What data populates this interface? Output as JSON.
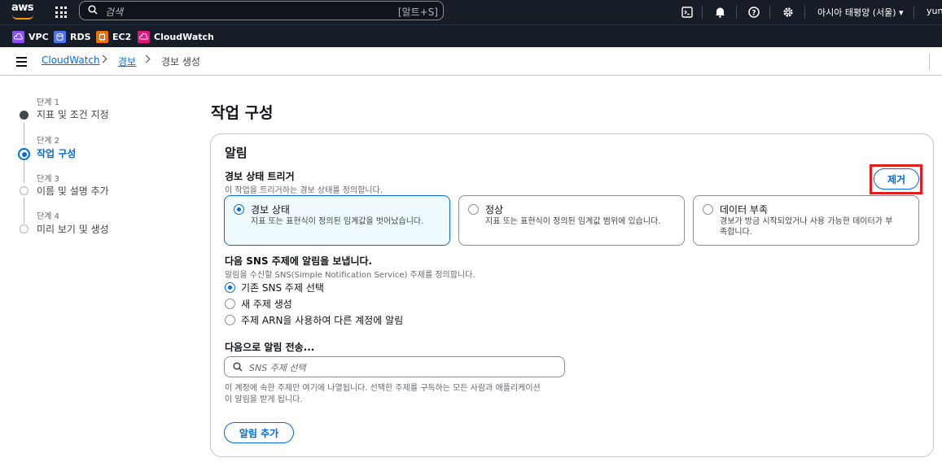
{
  "topnav": {
    "logo_text": "aws",
    "search_placeholder": "검색",
    "search_shortcut": "[알트+S]",
    "region": "아시아 태평양 (서울) ▾",
    "user": "yunj"
  },
  "favorites": [
    {
      "label": "VPC",
      "color": "#8c4fff"
    },
    {
      "label": "RDS",
      "color": "#4d72f3"
    },
    {
      "label": "EC2",
      "color": "#ed7100"
    },
    {
      "label": "CloudWatch",
      "color": "#e7157b"
    }
  ],
  "breadcrumb": {
    "items": [
      "CloudWatch",
      "경보",
      "경보 생성"
    ]
  },
  "steps": [
    {
      "label": "단계 1",
      "title": "지표 및 조건 지정",
      "state": "done"
    },
    {
      "label": "단계 2",
      "title": "작업 구성",
      "state": "active"
    },
    {
      "label": "단계 3",
      "title": "이름 및 설명 추가",
      "state": "todo"
    },
    {
      "label": "단계 4",
      "title": "미리 보기 및 생성",
      "state": "todo"
    }
  ],
  "main": {
    "title": "작업 구성",
    "card_title": "알림",
    "trigger_label": "경보 상태 트리거",
    "trigger_desc": "이 작업을 트리거하는 경보 상태를 정의합니다.",
    "remove_button": "제거",
    "tiles": [
      {
        "title": "경보 상태",
        "desc": "지표 또는 표현식이 정의된 임계값을 벗어났습니다.",
        "selected": true
      },
      {
        "title": "정상",
        "desc": "지표 또는 표현식이 정의된 임계값 범위에 있습니다.",
        "selected": false
      },
      {
        "title": "데이터 부족",
        "desc_line1": "경보가 방금 시작되었거나 사용 가능한 데이터가 부",
        "desc_line2": "족합니다.",
        "selected": false
      }
    ],
    "sns_label": "다음 SNS 주제에 알림을 보냅니다.",
    "sns_desc": "알림을 수신할 SNS(Simple Notification Service) 주제를 정의합니다.",
    "sns_options": [
      {
        "label": "기존 SNS 주제 선택",
        "selected": true
      },
      {
        "label": "새 주제 생성",
        "selected": false
      },
      {
        "label": "주제 ARN을 사용하여 다른 계정에 알림",
        "selected": false
      }
    ],
    "send_to_label": "다음으로 알림 전송...",
    "sns_input_placeholder": "SNS 주제 선택",
    "sns_hint_line1": "이 계정에 속한 주제만 여기에 나열됩니다. 선택한 주제를 구독하는 모든 사람과 애플리케이션",
    "sns_hint_line2": "이 알림을 받게 됩니다.",
    "add_notification_button": "알림 추가"
  }
}
